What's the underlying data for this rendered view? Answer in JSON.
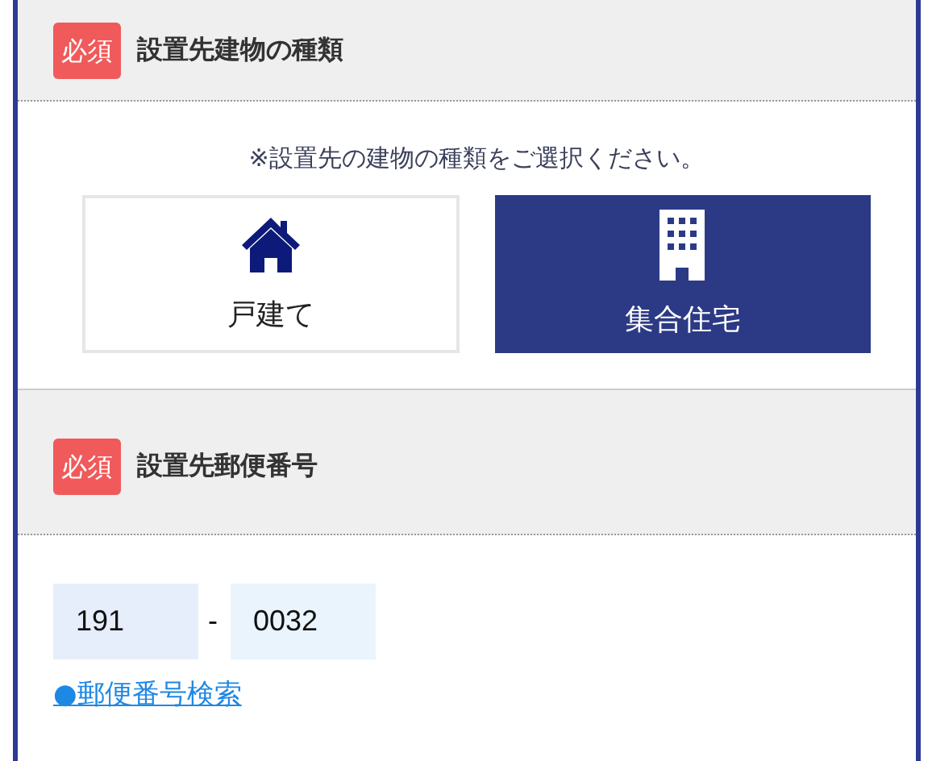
{
  "sections": [
    {
      "badge": "必須",
      "title": "設置先建物の種類",
      "note": "※設置先の建物の種類をご選択ください。",
      "options": [
        {
          "kind": "house",
          "label": "戸建て",
          "selected": false
        },
        {
          "kind": "building",
          "label": "集合住宅",
          "selected": true
        }
      ]
    },
    {
      "badge": "必須",
      "title": "設置先郵便番号",
      "postal": {
        "first": "191",
        "separator": "-",
        "second": "0032"
      },
      "link": "●郵便番号検索"
    }
  ]
}
